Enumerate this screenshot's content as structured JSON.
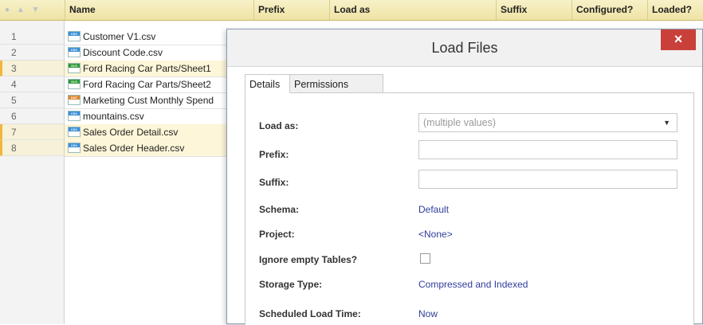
{
  "grid": {
    "header": {
      "name": "Name",
      "prefix": "Prefix",
      "load_as": "Load as",
      "suffix": "Suffix",
      "configured": "Configured?",
      "loaded": "Loaded?"
    },
    "rows": [
      {
        "num": "1",
        "name": "Customer V1.csv",
        "icon": "csv-file-icon"
      },
      {
        "num": "2",
        "name": "Discount Code.csv",
        "icon": "csv-file-icon"
      },
      {
        "num": "3",
        "name": "Ford Racing Car Parts/Sheet1",
        "icon": "xls-file-icon"
      },
      {
        "num": "4",
        "name": "Ford Racing Car Parts/Sheet2",
        "icon": "xls-file-icon"
      },
      {
        "num": "5",
        "name": "Marketing Cust Monthly Spend",
        "icon": "dat-file-icon"
      },
      {
        "num": "6",
        "name": "mountains.csv",
        "icon": "csv-file-icon"
      },
      {
        "num": "7",
        "name": "Sales Order Detail.csv",
        "icon": "csv-file-icon"
      },
      {
        "num": "8",
        "name": "Sales Order Header.csv",
        "icon": "csv-file-icon"
      }
    ]
  },
  "dialog": {
    "title": "Load Files",
    "close_label": "×",
    "tabs": [
      {
        "label": "Details"
      },
      {
        "label": "Permissions"
      }
    ],
    "fields": {
      "load_as_label": "Load as:",
      "load_as_value": "(multiple values)",
      "prefix_label": "Prefix:",
      "prefix_value": "",
      "suffix_label": "Suffix:",
      "suffix_value": "",
      "schema_label": "Schema:",
      "schema_value": "Default",
      "project_label": "Project:",
      "project_value": "<None>",
      "ignore_empty_label": "Ignore empty Tables?",
      "ignore_empty_checked": false,
      "storage_label": "Storage Type:",
      "storage_value": "Compressed and Indexed",
      "scheduled_label": "Scheduled Load Time:",
      "scheduled_value": "Now"
    }
  },
  "colors": {
    "header_bg": "#efe3a3",
    "highlight_row": "#fdf6d8",
    "highlight_marker": "#f0b73d",
    "link_value": "#2f3d9a",
    "close_button": "#c9403a",
    "status_dot": "#e05050"
  }
}
